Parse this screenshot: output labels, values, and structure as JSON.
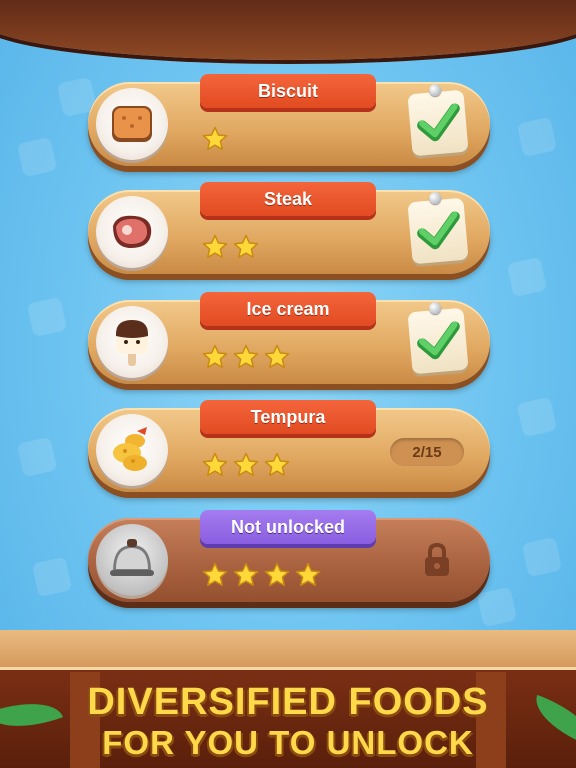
{
  "levels": [
    {
      "name": "Biscuit",
      "food_icon": "biscuit-icon",
      "stars": 1,
      "status": "completed",
      "status_icon": "check-icon"
    },
    {
      "name": "Steak",
      "food_icon": "steak-icon",
      "stars": 2,
      "status": "completed",
      "status_icon": "check-icon"
    },
    {
      "name": "Ice cream",
      "food_icon": "ice-cream-icon",
      "stars": 3,
      "status": "completed",
      "status_icon": "check-icon"
    },
    {
      "name": "Tempura",
      "food_icon": "tempura-icon",
      "stars": 3,
      "status": "in-progress",
      "progress": "2/15"
    },
    {
      "name": "Not unlocked",
      "food_icon": "cloche-icon",
      "stars": 4,
      "status": "locked",
      "status_icon": "lock-icon"
    }
  ],
  "promo": {
    "line1": "DIVERSIFIED FOODS",
    "line2": "FOR YOU TO UNLOCK"
  },
  "colors": {
    "background": "#6cc3f0",
    "ribbon_red": "#e24b22",
    "ribbon_purple": "#8a5ee0",
    "star": "#ffd83a",
    "check": "#3fb54a",
    "promo_text": "#ffd94a"
  }
}
